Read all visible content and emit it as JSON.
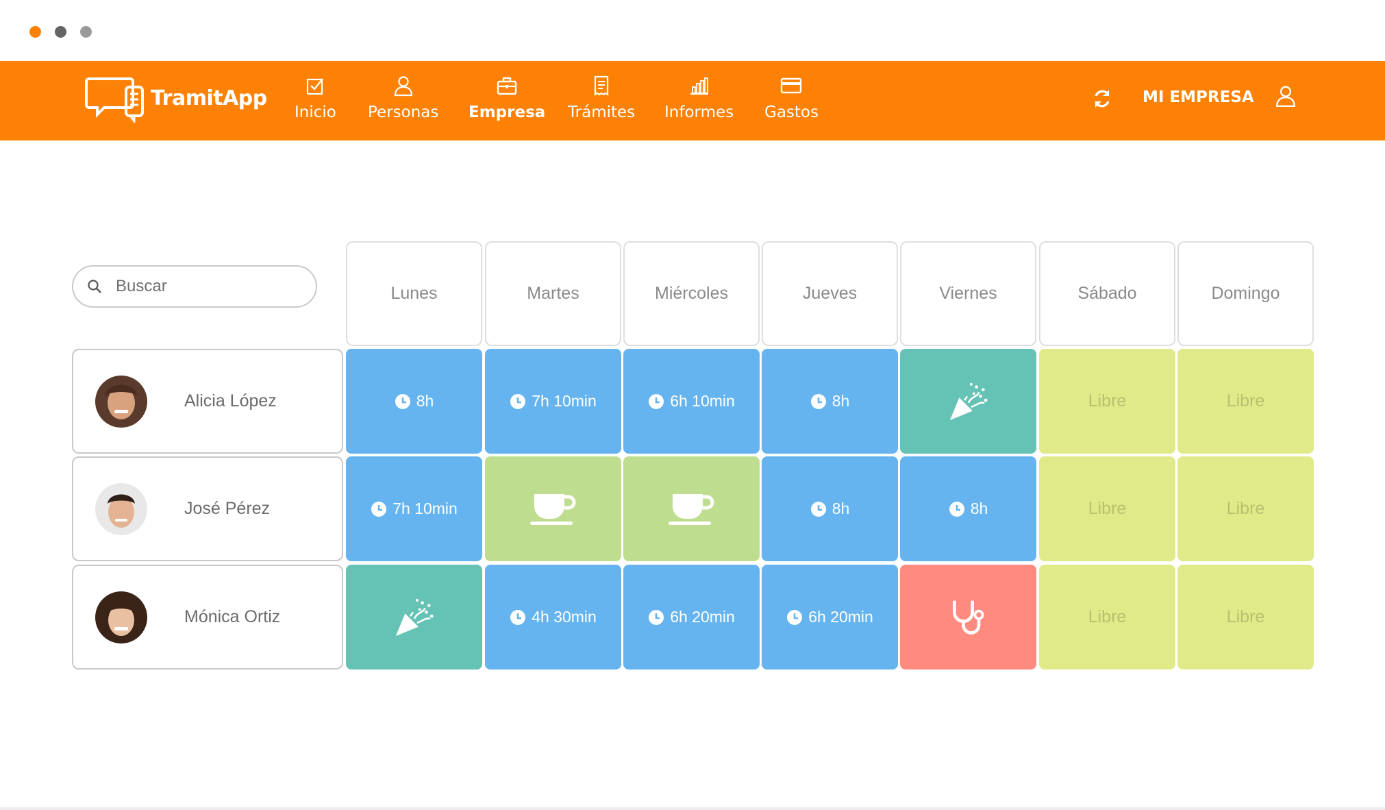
{
  "window": {
    "dots": [
      {
        "color": "#fd8105"
      },
      {
        "color": "#646464"
      },
      {
        "color": "#9a9a9a"
      }
    ]
  },
  "colors": {
    "brand": "#fd8105",
    "work": "#65b4ef",
    "holiday": "#65c3b6",
    "rest": "#bedd8e",
    "libre": "#e1ea88",
    "medical": "#ff8a80"
  },
  "header": {
    "logo_text_a": "Tramit",
    "logo_text_b": "App",
    "nav": [
      {
        "label": "Inicio",
        "icon": "checkbox-icon"
      },
      {
        "label": "Personas",
        "icon": "person-icon"
      },
      {
        "label": "Empresa",
        "icon": "briefcase-icon",
        "active": true
      },
      {
        "label": "Trámites",
        "icon": "document-icon"
      },
      {
        "label": "Informes",
        "icon": "bar-chart-icon"
      },
      {
        "label": "Gastos",
        "icon": "credit-card-icon"
      }
    ],
    "refresh_icon": "refresh-icon",
    "company_label": "MI EMPRESA",
    "user_icon": "user-icon"
  },
  "search": {
    "placeholder": "Buscar",
    "value": ""
  },
  "days": [
    "Lunes",
    "Martes",
    "Miércoles",
    "Jueves",
    "Viernes",
    "Sábado",
    "Domingo"
  ],
  "people": [
    {
      "name": "Alicia López",
      "cells": [
        {
          "type": "work",
          "text": "8h"
        },
        {
          "type": "work",
          "text": "7h 10min"
        },
        {
          "type": "work",
          "text": "6h 10min"
        },
        {
          "type": "work",
          "text": "8h"
        },
        {
          "type": "holiday",
          "icon": "party-popper-icon"
        },
        {
          "type": "libre",
          "text": "Libre"
        },
        {
          "type": "libre",
          "text": "Libre"
        }
      ]
    },
    {
      "name": "José Pérez",
      "cells": [
        {
          "type": "work",
          "text": "7h 10min"
        },
        {
          "type": "rest",
          "icon": "coffee-cup-icon"
        },
        {
          "type": "rest",
          "icon": "coffee-cup-icon"
        },
        {
          "type": "work",
          "text": "8h"
        },
        {
          "type": "work",
          "text": "8h"
        },
        {
          "type": "libre",
          "text": "Libre"
        },
        {
          "type": "libre",
          "text": "Libre"
        }
      ]
    },
    {
      "name": "Mónica Ortiz",
      "cells": [
        {
          "type": "holiday",
          "icon": "party-popper-icon"
        },
        {
          "type": "work",
          "text": "4h 30min"
        },
        {
          "type": "work",
          "text": "6h 20min"
        },
        {
          "type": "work",
          "text": "6h 20min"
        },
        {
          "type": "medical",
          "icon": "stethoscope-icon"
        },
        {
          "type": "libre",
          "text": "Libre"
        },
        {
          "type": "libre",
          "text": "Libre"
        }
      ]
    }
  ]
}
